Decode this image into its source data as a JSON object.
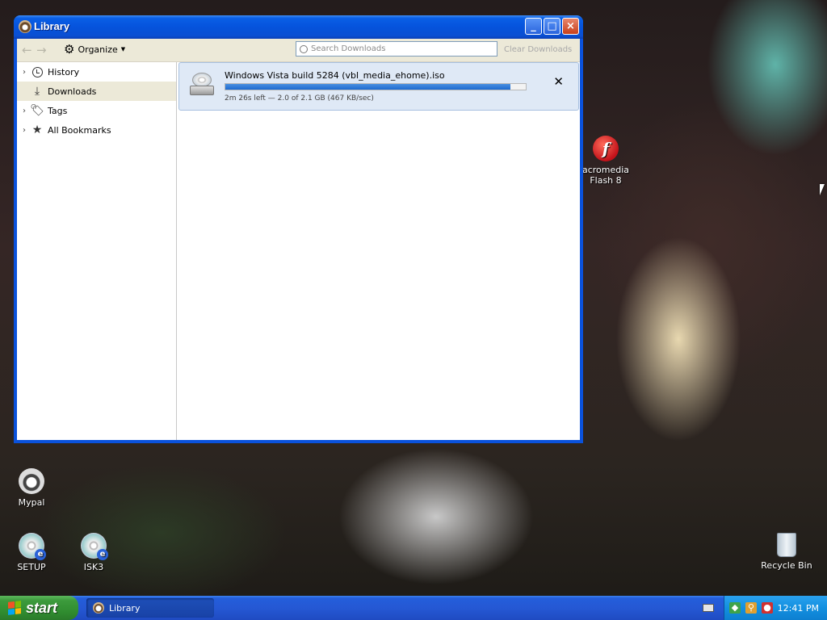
{
  "window": {
    "title": "Library",
    "controls": {
      "minimize": "_",
      "maximize": "□",
      "close": "×"
    }
  },
  "toolbar": {
    "back_icon": "back-arrow-icon",
    "forward_icon": "forward-arrow-icon",
    "organize_label": "Organize",
    "organize_icon": "gear-icon",
    "search": {
      "placeholder": "Search Downloads",
      "value": ""
    },
    "clear_label": "Clear Downloads"
  },
  "sidebar": {
    "items": [
      {
        "label": "History",
        "icon": "clock-icon",
        "expandable": true,
        "selected": false
      },
      {
        "label": "Downloads",
        "icon": "download-arrow-icon",
        "expandable": false,
        "selected": true
      },
      {
        "label": "Tags",
        "icon": "tag-icon",
        "expandable": true,
        "selected": false
      },
      {
        "label": "All Bookmarks",
        "icon": "star-icon",
        "expandable": true,
        "selected": false
      }
    ]
  },
  "downloads": [
    {
      "name": "Windows Vista build 5284 (vbl_media_ehome).iso",
      "status": "2m 26s left — 2.0 of 2.1 GB (467 KB/sec)",
      "progress": 0.95,
      "icon": "cd-drive-icon"
    }
  ],
  "desktop": {
    "icons": [
      {
        "label": "acromedia\nFlash 8",
        "icon": "macromedia-flash-icon"
      },
      {
        "label": "Mypal",
        "icon": "mypal-icon"
      },
      {
        "label": "SETUP",
        "icon": "cd-ie-icon"
      },
      {
        "label": "ISK3",
        "icon": "cd-ie-icon"
      },
      {
        "label": "Recycle Bin",
        "icon": "recycle-bin-icon"
      }
    ]
  },
  "taskbar": {
    "start_label": "start",
    "tasks": [
      {
        "label": "Library"
      }
    ],
    "clock": "12:41 PM"
  },
  "colors": {
    "titlebar": "#0553dc",
    "selected_row": "#dfe9f6",
    "progress": "#1c6ad0",
    "taskbar": "#245edb",
    "start": "#3c9b3c",
    "tray": "#1390e0"
  }
}
